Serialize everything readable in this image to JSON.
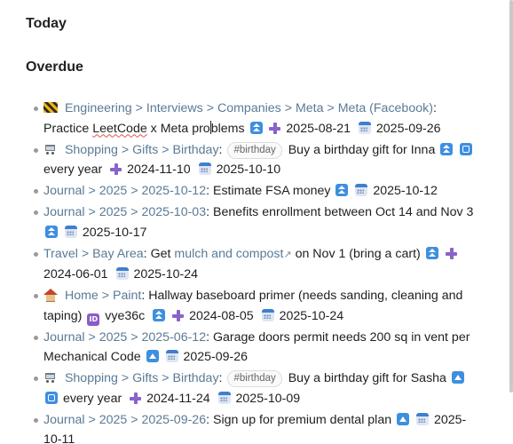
{
  "sections": {
    "today": "Today",
    "overdue": "Overdue"
  },
  "tasks": [
    {
      "icon": "construction-icon",
      "crumbs": [
        "Engineering",
        "Interviews",
        "Companies",
        "Meta",
        "Meta (Facebook)"
      ],
      "text_before": "Practice ",
      "text_spell": "LeetCode",
      "text_mid": " x Meta pro",
      "text_after": "blems",
      "priority": "highest",
      "created": "2025-08-21",
      "due": "2025-09-26"
    },
    {
      "icon": "shopping-cart-icon",
      "crumbs": [
        "Shopping",
        "Gifts",
        "Birthday"
      ],
      "tag": "#birthday",
      "text": "Buy a birthday gift for Inna",
      "priority": "highest",
      "recurrence": "every year",
      "created": "2024-11-10",
      "due": "2025-10-10"
    },
    {
      "crumbs": [
        "Journal",
        "2025",
        "2025-10-12"
      ],
      "text": "Estimate FSA money",
      "priority": "highest",
      "due": "2025-10-12"
    },
    {
      "crumbs": [
        "Journal",
        "2025",
        "2025-10-03"
      ],
      "text": "Benefits enrollment between Oct 14 and Nov 3",
      "priority": "highest",
      "due": "2025-10-17"
    },
    {
      "crumbs": [
        "Travel",
        "Bay Area"
      ],
      "text_before": "Get ",
      "link": "mulch and compost",
      "text_after": " on Nov 1 (bring a cart)",
      "priority": "highest",
      "created": "2024-06-01",
      "due": "2025-10-24"
    },
    {
      "icon": "house-icon",
      "crumbs": [
        "Home",
        "Paint"
      ],
      "text": "Hallway baseboard primer (needs sanding, cleaning and taping)",
      "id": "vye36c",
      "priority": "highest",
      "created": "2024-08-05",
      "due": "2025-10-24"
    },
    {
      "crumbs": [
        "Journal",
        "2025",
        "2025-06-12"
      ],
      "text": "Garage doors permit needs 200 sq in vent per Mechanical Code",
      "priority": "medium",
      "due": "2025-09-26"
    },
    {
      "icon": "shopping-cart-icon",
      "crumbs": [
        "Shopping",
        "Gifts",
        "Birthday"
      ],
      "tag": "#birthday",
      "text": "Buy a birthday gift for Sasha",
      "priority": "medium",
      "recurrence": "every year",
      "created": "2024-11-24",
      "due": "2025-10-09"
    },
    {
      "crumbs": [
        "Journal",
        "2025",
        "2025-09-26"
      ],
      "text": "Sign up for premium dental plan",
      "priority": "medium",
      "due": "2025-10-11"
    }
  ],
  "separator": ">"
}
